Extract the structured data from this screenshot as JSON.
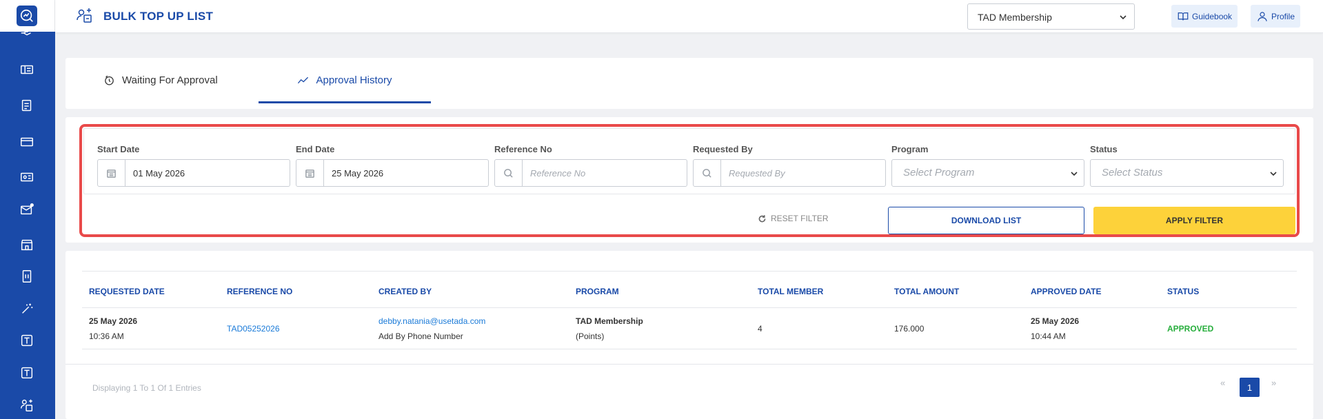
{
  "header": {
    "title": "BULK TOP UP LIST",
    "membership_select": "TAD Membership",
    "guidebook_label": "Guidebook",
    "profile_label": "Profile"
  },
  "tabs": [
    {
      "label": "Waiting For Approval",
      "icon": "timer-icon",
      "active": false
    },
    {
      "label": "Approval History",
      "icon": "trend-line-icon",
      "active": true
    }
  ],
  "filters": {
    "start_date_label": "Start Date",
    "start_date_value": "01 May 2026",
    "end_date_label": "End Date",
    "end_date_value": "25 May 2026",
    "reference_label": "Reference No",
    "reference_placeholder": "Reference No",
    "requested_by_label": "Requested By",
    "requested_by_placeholder": "Requested By",
    "program_label": "Program",
    "program_placeholder": "Select Program",
    "status_label": "Status",
    "status_placeholder": "Select Status",
    "reset_label": "RESET FILTER",
    "download_label": "DOWNLOAD LIST",
    "apply_label": "APPLY FILTER"
  },
  "table": {
    "columns": [
      "REQUESTED DATE",
      "REFERENCE NO",
      "CREATED BY",
      "PROGRAM",
      "TOTAL MEMBER",
      "TOTAL AMOUNT",
      "APPROVED DATE",
      "STATUS"
    ],
    "rows": [
      {
        "requested_date": "25 May 2026",
        "requested_time": "10:36 AM",
        "reference_no": "TAD05252026",
        "created_by_email": "debby.natania@usetada.com",
        "created_by_method": "Add By Phone Number",
        "program_name": "TAD Membership",
        "program_type": "(Points)",
        "total_member": "4",
        "total_amount": "176.000",
        "approved_date": "25 May 2026",
        "approved_time": "10:44 AM",
        "status": "APPROVED"
      }
    ]
  },
  "pagination": {
    "summary": "Displaying 1 To 1 Of 1 Entries",
    "prev": "«",
    "current": "1",
    "next": "»"
  },
  "colors": {
    "brand": "#1a4aa8",
    "accent_yellow": "#fdd23a",
    "status_green": "#27ae3c",
    "link_blue": "#1a7ad8",
    "highlight_red": "#e94a4a"
  }
}
